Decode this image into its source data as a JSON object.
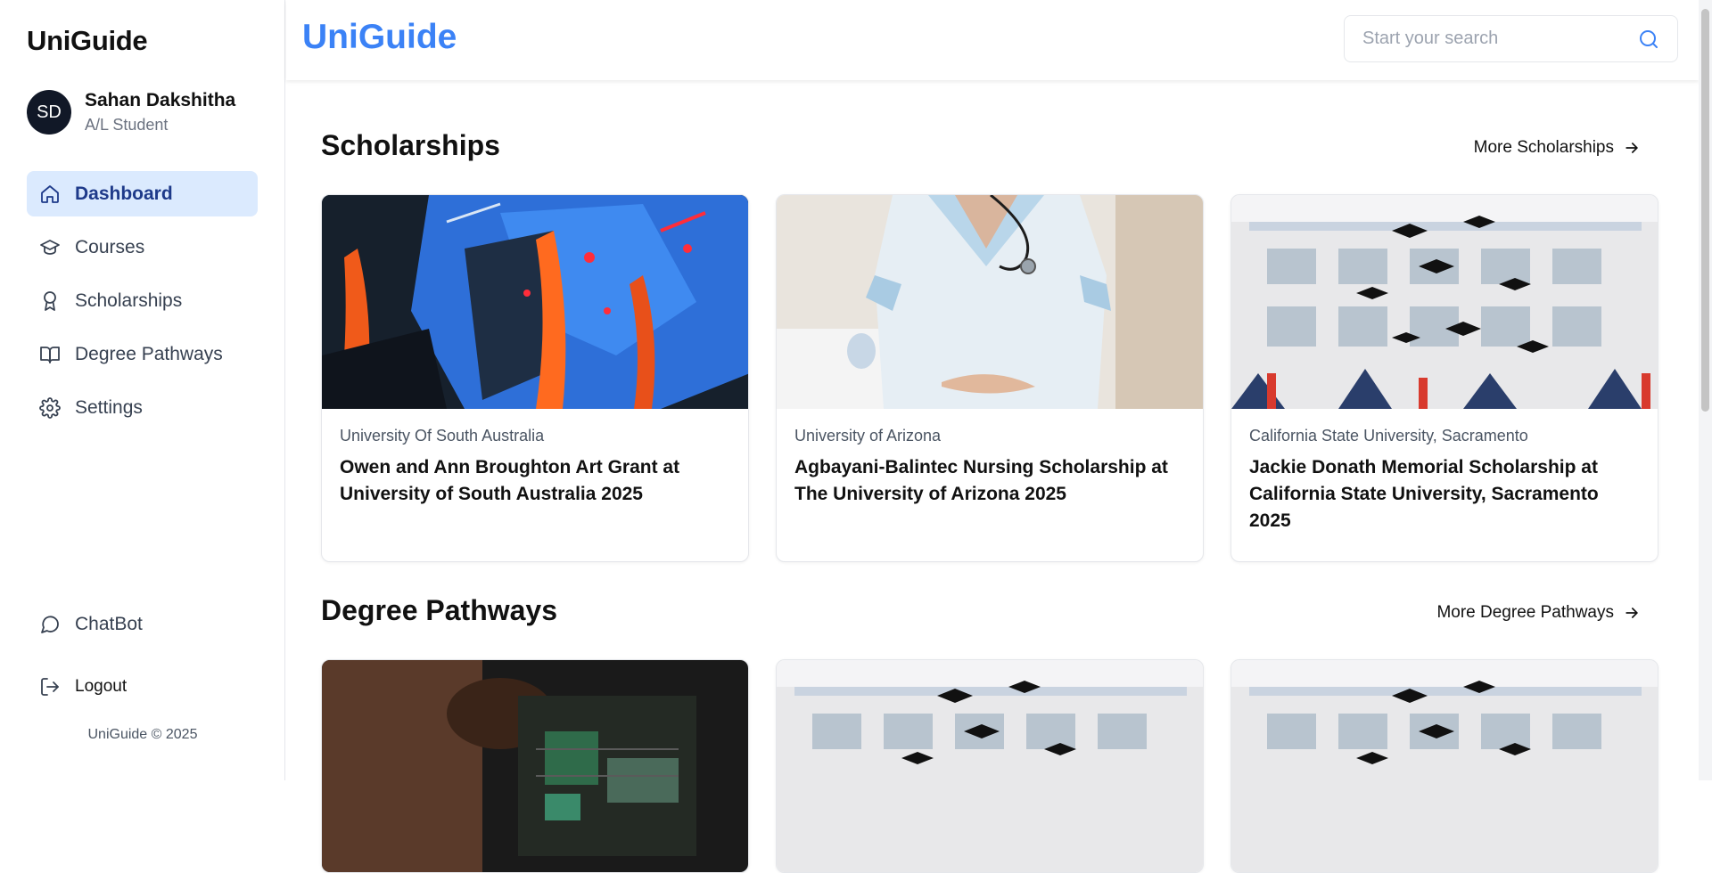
{
  "sidebar": {
    "brand": "UniGuide",
    "user": {
      "initials": "SD",
      "name": "Sahan Dakshitha",
      "role": "A/L Student"
    },
    "nav": [
      {
        "label": "Dashboard",
        "icon": "home-icon",
        "active": true
      },
      {
        "label": "Courses",
        "icon": "graduation-cap-icon"
      },
      {
        "label": "Scholarships",
        "icon": "award-icon"
      },
      {
        "label": "Degree Pathways",
        "icon": "book-open-icon"
      },
      {
        "label": "Settings",
        "icon": "gear-icon"
      }
    ],
    "chatbot": "ChatBot",
    "logout": "Logout",
    "footer": "UniGuide © 2025"
  },
  "header": {
    "brand": "UniGuide",
    "search_placeholder": "Start your search"
  },
  "scholarships": {
    "title": "Scholarships",
    "more": "More Scholarships",
    "cards": [
      {
        "university": "University Of South Australia",
        "title": "Owen and Ann Broughton Art Grant at University of South Australia 2025",
        "image": "abstract-painting"
      },
      {
        "university": "University of Arizona",
        "title": "Agbayani-Balintec Nursing Scholarship at The University of Arizona 2025",
        "image": "nurse-stethoscope"
      },
      {
        "university": "California State University, Sacramento",
        "title": "Jackie Donath Memorial Scholarship at California State University, Sacramento 2025",
        "image": "graduation-caps"
      }
    ]
  },
  "pathways": {
    "title": "Degree Pathways",
    "more": "More Degree Pathways",
    "cards": [
      {
        "image": "circuit-board"
      },
      {
        "image": "graduation-caps"
      },
      {
        "image": "graduation-caps"
      }
    ]
  },
  "colors": {
    "accent": "#3b82f6",
    "active_bg": "#dbeafe",
    "active_text": "#1e3a8a"
  }
}
